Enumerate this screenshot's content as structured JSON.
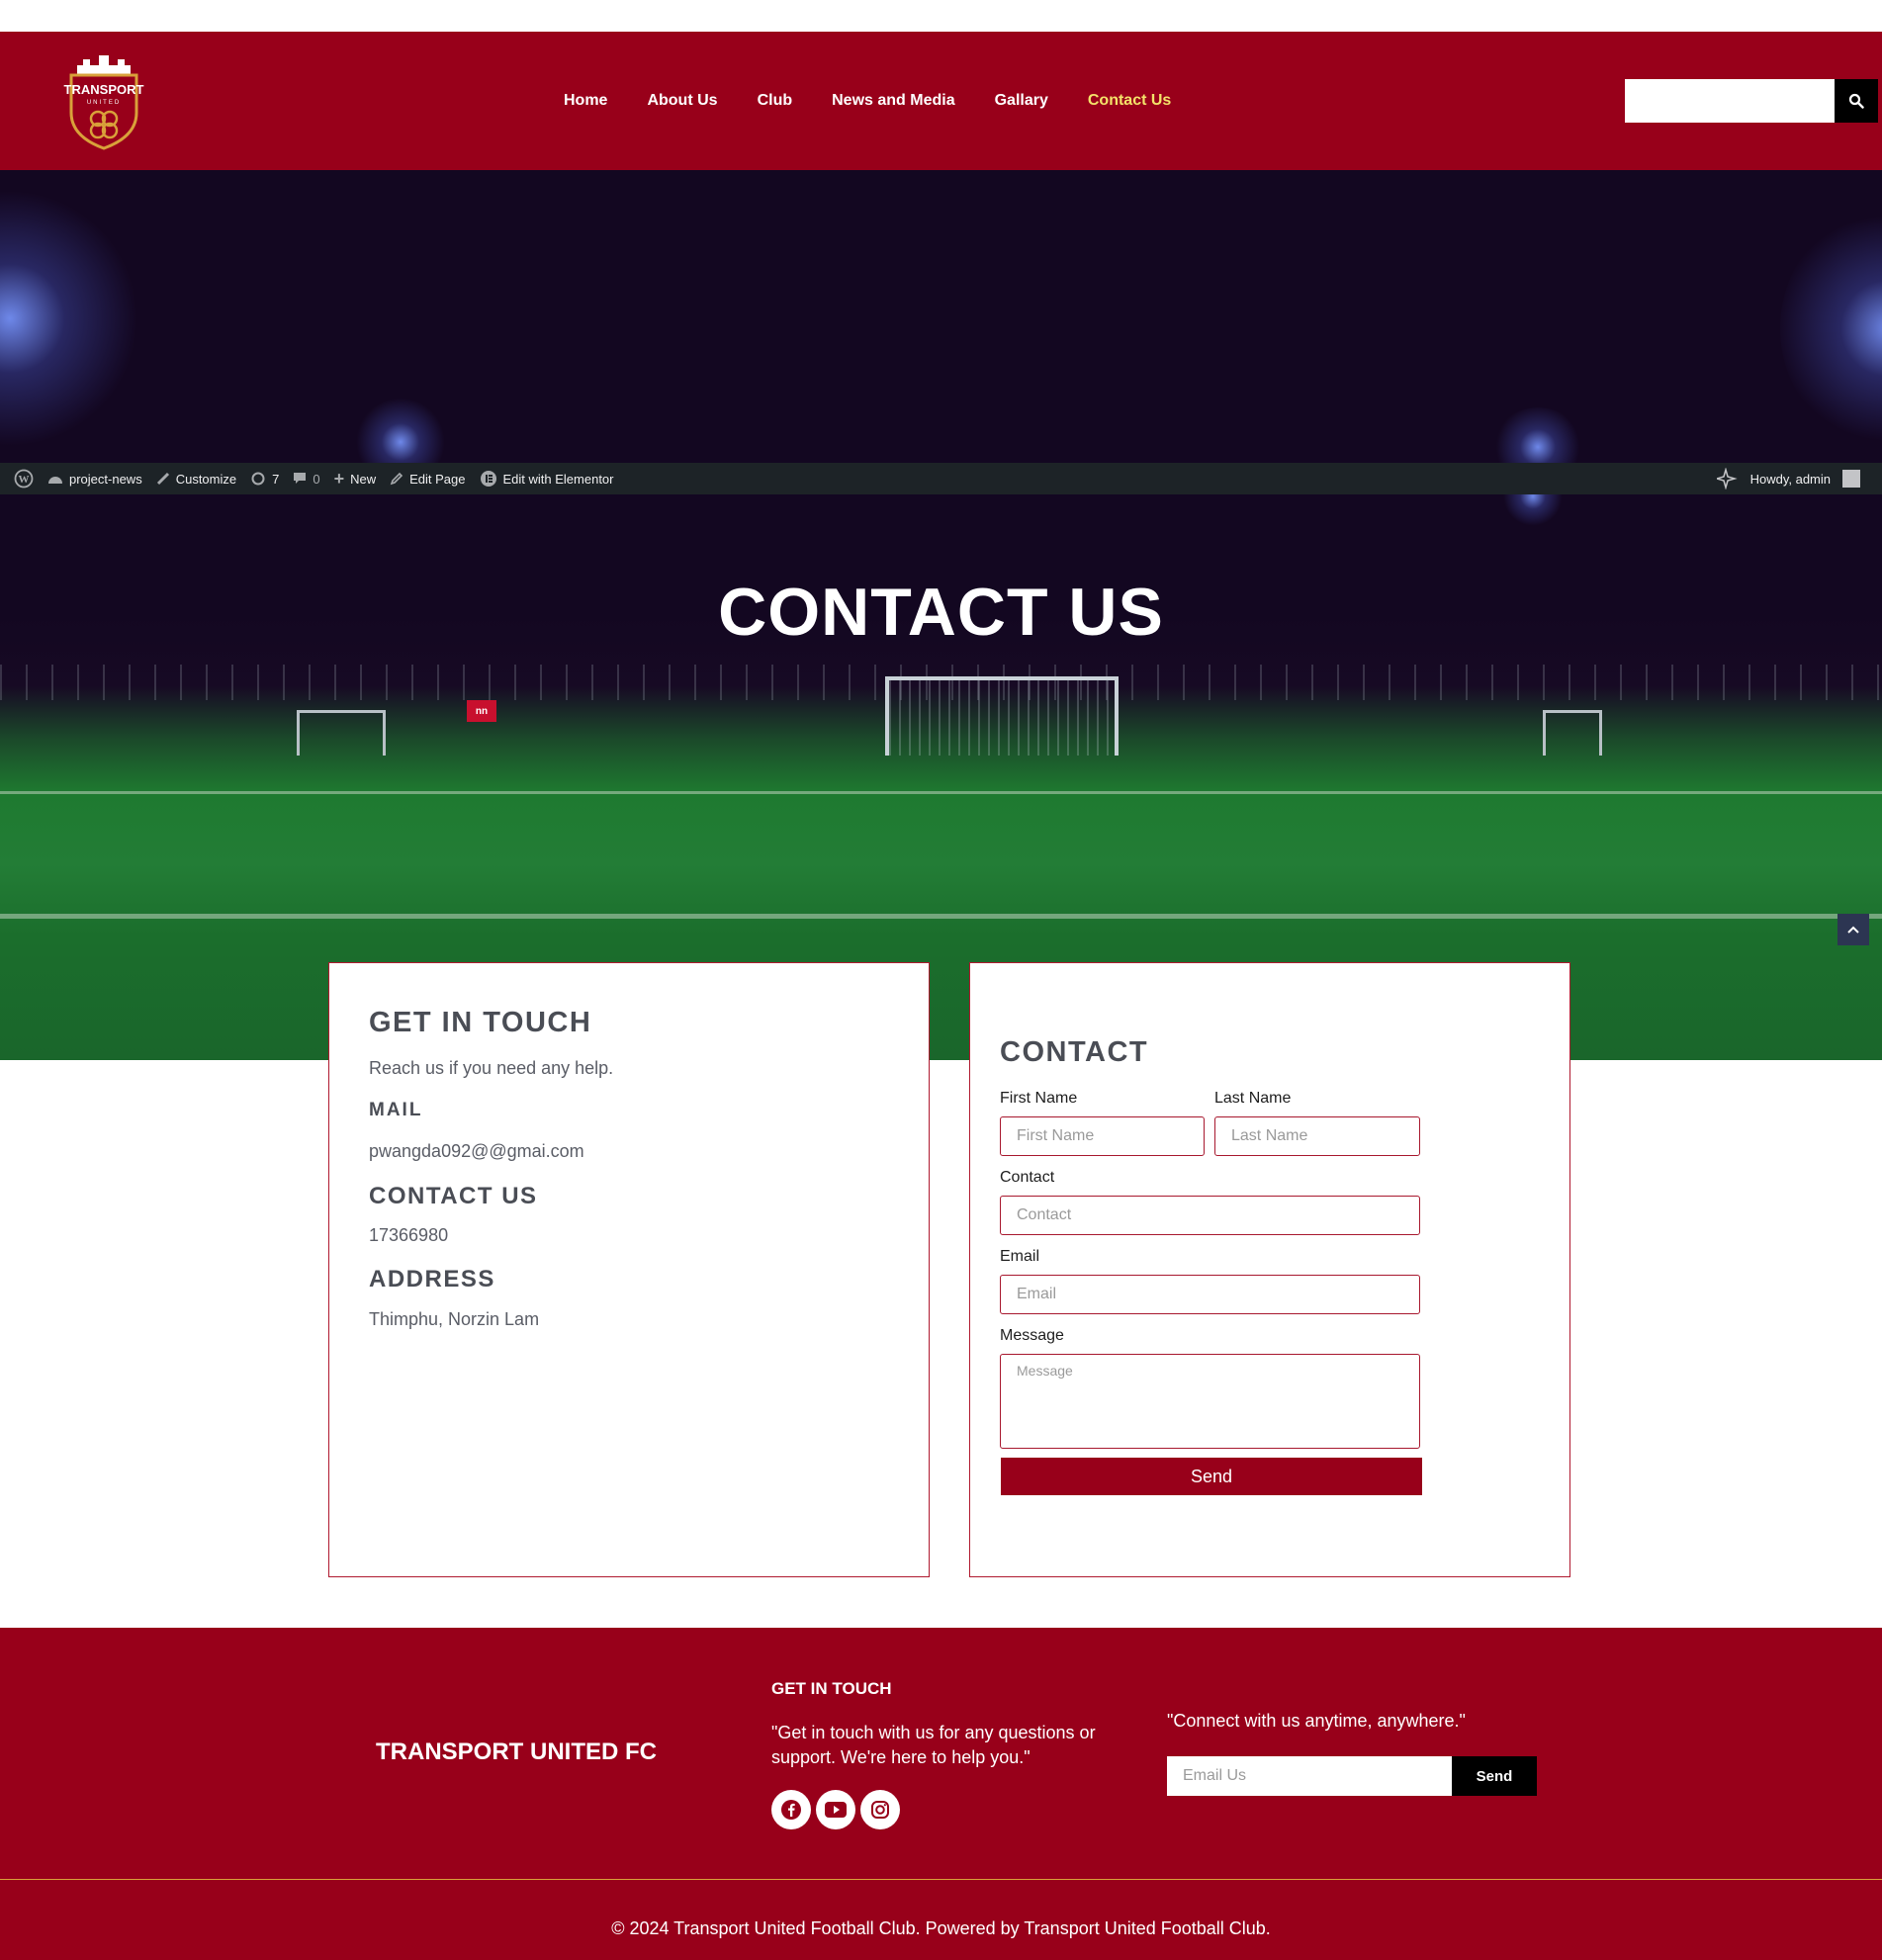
{
  "header": {
    "logo_text": "TRANSPORT",
    "logo_subtext": "UNITED",
    "nav": [
      {
        "label": "Home"
      },
      {
        "label": "About Us"
      },
      {
        "label": "Club"
      },
      {
        "label": "News and Media"
      },
      {
        "label": "Gallary"
      },
      {
        "label": "Contact Us"
      }
    ],
    "active_nav": "Contact Us",
    "search_icon": "search-icon"
  },
  "adminbar": {
    "site_name": "project-news",
    "customize": "Customize",
    "updates_count": "7",
    "comments_count": "0",
    "new_label": "New",
    "edit_page": "Edit Page",
    "edit_elementor": "Edit with Elementor",
    "howdy": "Howdy, admin"
  },
  "hero": {
    "title": "CONTACT US",
    "signboard": "nn"
  },
  "info_card": {
    "heading": "GET IN TOUCH",
    "intro": "Reach us if you need any help.",
    "mail_heading": "MAIL",
    "mail_value": "pwangda092@@gmai.com",
    "contact_heading": "CONTACT US",
    "contact_value": "17366980",
    "address_heading": "ADDRESS",
    "address_value": "Thimphu, Norzin Lam"
  },
  "form_card": {
    "heading": "CONTACT",
    "first_name_label": "First Name",
    "first_name_placeholder": "First Name",
    "last_name_label": "Last Name",
    "last_name_placeholder": "Last Name",
    "contact_label": "Contact",
    "contact_placeholder": "Contact",
    "email_label": "Email",
    "email_placeholder": "Email",
    "message_label": "Message",
    "message_placeholder": "Message",
    "send_label": "Send"
  },
  "footer": {
    "brand": "TRANSPORT UNITED FC",
    "get_in_touch_heading": "GET IN TOUCH",
    "get_in_touch_text": "\"Get in touch with us for any questions or support. We're here to help you.\"",
    "socials": [
      "facebook-icon",
      "youtube-icon",
      "instagram-icon"
    ],
    "quote": "\"Connect with us anytime, anywhere.\"",
    "email_placeholder": "Email Us",
    "send_label": "Send",
    "copyright": "© 2024 Transport United Football Club. Powered by Transport United Football Club."
  },
  "colors": {
    "brand_red": "#98001a",
    "active_nav": "#f4e36a",
    "admin_bar": "#1d2327"
  }
}
